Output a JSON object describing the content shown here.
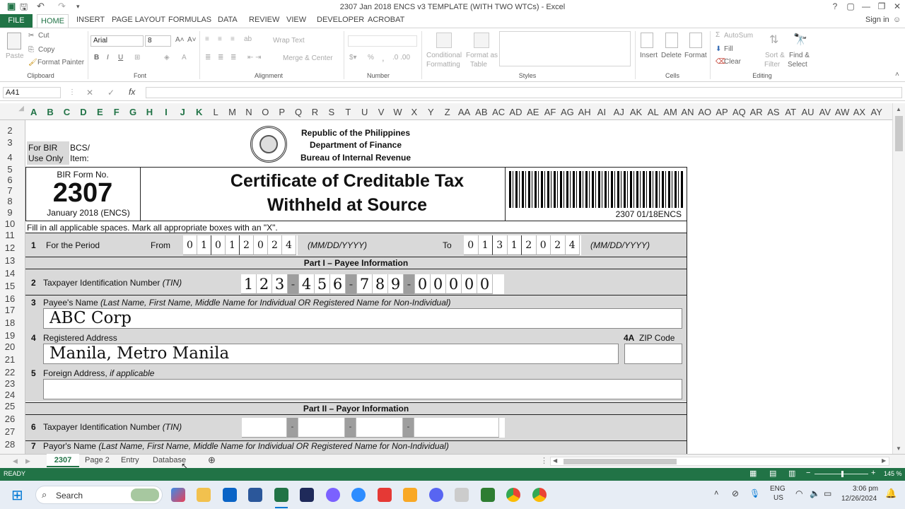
{
  "window": {
    "title": "2307 Jan 2018 ENCS v3 TEMPLATE (WITH TWO WTCs) - Excel",
    "help": "?",
    "controls": [
      "▢",
      "—",
      "❐",
      "✕"
    ]
  },
  "tabs": {
    "file": "FILE",
    "items": [
      "HOME",
      "INSERT",
      "PAGE LAYOUT",
      "FORMULAS",
      "DATA",
      "REVIEW",
      "VIEW",
      "DEVELOPER",
      "ACROBAT"
    ],
    "signin": "Sign in"
  },
  "ribbon": {
    "clipboard": {
      "paste": "Paste",
      "cut": "Cut",
      "copy": "Copy",
      "format_painter": "Format Painter",
      "label": "Clipboard"
    },
    "font": {
      "name": "Arial",
      "size": "8",
      "label": "Font",
      "bold": "B",
      "italic": "I",
      "underline": "U"
    },
    "alignment": {
      "wrap": "Wrap Text",
      "merge": "Merge & Center",
      "label": "Alignment"
    },
    "number": {
      "label": "Number",
      "percent": "%",
      "comma": ","
    },
    "styles": {
      "conditional": "Conditional",
      "formatting": "Formatting",
      "format_as": "Format as",
      "table": "Table",
      "label": "Styles"
    },
    "cells": {
      "insert": "Insert",
      "delete": "Delete",
      "format": "Format",
      "label": "Cells"
    },
    "editing": {
      "autosum": "AutoSum",
      "fill": "Fill",
      "clear": "Clear",
      "sort": "Sort &",
      "filter": "Filter",
      "find": "Find &",
      "select": "Select",
      "label": "Editing"
    }
  },
  "formula_bar": {
    "name_box": "A41",
    "fx": "fx",
    "value": ""
  },
  "columns": [
    "A",
    "B",
    "C",
    "D",
    "E",
    "F",
    "G",
    "H",
    "I",
    "J",
    "K",
    "L",
    "M",
    "N",
    "O",
    "P",
    "Q",
    "R",
    "S",
    "T",
    "U",
    "V",
    "W",
    "X",
    "Y",
    "Z",
    "AA",
    "AB",
    "AC",
    "AD",
    "AE",
    "AF",
    "AG",
    "AH",
    "AI",
    "AJ",
    "AK",
    "AL",
    "AM",
    "AN",
    "AO",
    "AP",
    "AQ",
    "AR",
    "AS",
    "AT",
    "AU",
    "AV",
    "AW",
    "AX",
    "AY"
  ],
  "rows": [
    "2",
    "3",
    "4",
    "5",
    "6",
    "7",
    "8",
    "9",
    "10",
    "11",
    "12",
    "13",
    "14",
    "15",
    "16",
    "17",
    "18",
    "19",
    "20",
    "21",
    "22",
    "23",
    "24",
    "25",
    "26",
    "27",
    "28"
  ],
  "form": {
    "republic": "Republic of the Philippines",
    "department": "Department of Finance",
    "bureau": "Bureau of Internal Revenue",
    "for_bir": "For BIR",
    "use_only": "Use Only",
    "bcs": "BCS/",
    "item": "Item:",
    "form_no_label": "BIR Form No.",
    "form_no": "2307",
    "form_date": "January 2018 (ENCS)",
    "title_line1": "Certificate of Creditable Tax",
    "title_line2": "Withheld at Source",
    "barcode_text": "2307 01/18ENCS",
    "instructions": "Fill in all applicable spaces. Mark all appropriate boxes with an \"X\".",
    "period": {
      "num": "1",
      "label": "For the Period",
      "from": "From",
      "to": "To",
      "from_digits": [
        "0",
        "1",
        "0",
        "1",
        "2",
        "0",
        "2",
        "4"
      ],
      "to_digits": [
        "0",
        "1",
        "3",
        "1",
        "2",
        "0",
        "2",
        "4"
      ],
      "format": "(MM/DD/YYYY)"
    },
    "part1": "Part I – Payee Information",
    "tin": {
      "num": "2",
      "label": "Taxpayer Identification Number",
      "label_it": "(TIN)",
      "digits": [
        "1",
        "2",
        "3",
        "-",
        "4",
        "5",
        "6",
        "-",
        "7",
        "8",
        "9",
        "-",
        "0",
        "0",
        "0",
        "0",
        "0"
      ]
    },
    "payee_name": {
      "num": "3",
      "label": "Payee's Name",
      "label_it": "(Last Name, First Name, Middle Name for Individual OR Registered Name for Non-Individual)",
      "value": "ABC Corp"
    },
    "address": {
      "num": "4",
      "label": "Registered Address",
      "value": "Manila, Metro Manila",
      "zip_num": "4A",
      "zip_label": "ZIP Code"
    },
    "foreign": {
      "num": "5",
      "label": "Foreign Address,",
      "label_it": "if applicable"
    },
    "part2": "Part II – Payor Information",
    "payor_tin": {
      "num": "6",
      "label": "Taxpayer Identification Number",
      "label_it": "(TIN)"
    },
    "payor_name": {
      "num": "7",
      "label": "Payor's Name",
      "label_it": "(Last Name, First Name, Middle Name for Individual OR Registered Name for Non-Individual)"
    }
  },
  "sheets": [
    "2307",
    "Page 2",
    "Entry",
    "Database"
  ],
  "status": {
    "ready": "READY",
    "zoom": "145 %"
  },
  "taskbar": {
    "search": "Search",
    "lang1": "ENG",
    "lang2": "US",
    "time": "3:06 pm",
    "date": "12/26/2024"
  }
}
